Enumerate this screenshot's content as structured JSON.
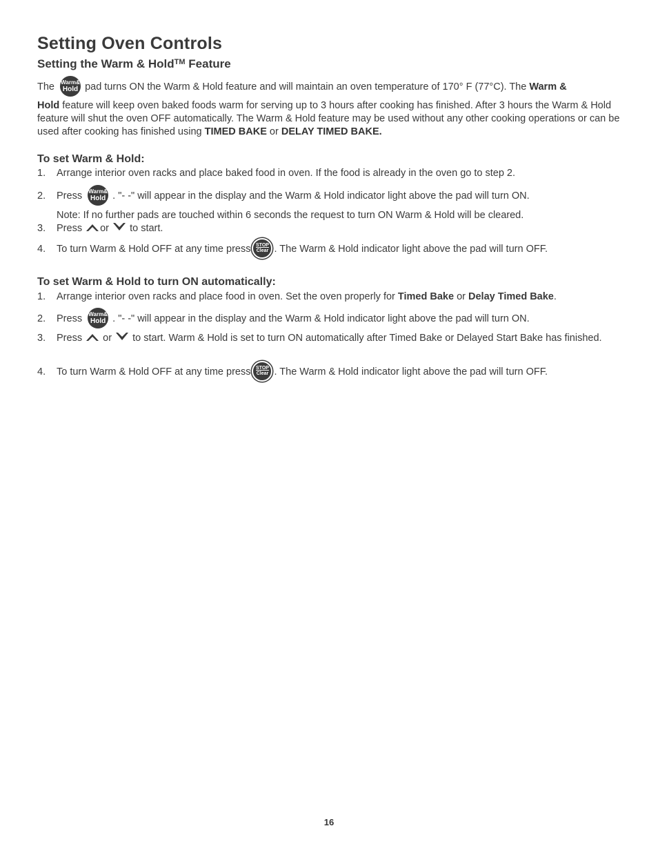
{
  "title": "Setting Oven Controls",
  "subtitle": "Setting the Warm & Hold",
  "subtitle_tm": "TM",
  "subtitle_end": " Feature",
  "icons": {
    "warm_hold_pad": {
      "name": "warm-hold-pad-icon",
      "line1": "Warm&",
      "line2": "Hold"
    },
    "stop_clear_pad": {
      "name": "stop-clear-pad-icon",
      "line1": "STOP",
      "line2": "Clear"
    },
    "up_arrow": "up-arrow-icon",
    "down_arrow": "down-arrow-icon"
  },
  "intro": {
    "p1_a": "The",
    "p1_b": "pad turns ON the Warm & Hold feature and will maintain an oven temperature of 170° F (77°C). The",
    "p1_bold1": "Warm &",
    "p2_bold": "Hold",
    "p2_a": "feature will keep oven baked foods warm for serving up to 3 hours after cooking has finished. After 3 hours the Warm & Hold feature will shut the oven OFF automatically. The Warm & Hold feature may be used without any other cooking operations or can be used after cooking has finished using",
    "p2_bold2": "TIMED BAKE",
    "p2_or": "or",
    "p2_bold3": "DELAY TIMED BAKE."
  },
  "section1": {
    "heading": "To set Warm & Hold:",
    "steps": [
      {
        "num": "1.",
        "text": "Arrange interior oven racks and place baked food in oven. If the food is already in the oven go to step 2."
      },
      {
        "num": "2.",
        "text_a": "Press",
        "text_b": ".  \"- -\" will appear in the display and the Warm & Hold indicator light above the pad will turn ON."
      },
      {
        "note": "Note: If no further pads are touched within 6 seconds the request to turn ON Warm & Hold will be cleared."
      },
      {
        "num": "3.",
        "text_a": "Press",
        "text_or": "or",
        "text_b": "to start."
      },
      {
        "num": "4.",
        "text_a": "To turn Warm & Hold OFF at any time press",
        "text_b": ". The Warm & Hold indicator light above the pad will turn OFF."
      }
    ]
  },
  "section2": {
    "heading": "To set Warm & Hold to turn ON automatically:",
    "steps": [
      {
        "num": "1.",
        "text_a": "Arrange interior oven racks and place food in oven. Set the oven properly for",
        "bold1": "Timed Bake",
        "text_or": "or",
        "bold2": "Delay Timed Bake",
        "text_end": "."
      },
      {
        "num": "2.",
        "text_a": "Press",
        "text_b": ".  \"- -\" will appear in the display and the Warm & Hold indicator light above the pad will turn ON."
      },
      {
        "num": "3.",
        "text_a": "Press",
        "text_or": "or",
        "text_b": "to start. Warm & Hold is set to turn ON automatically after Timed Bake or Delayed Start Bake has finished."
      },
      {
        "num": "4.",
        "text_a": "To turn Warm & Hold OFF at any time press",
        "text_b": ". The Warm & Hold indicator light above the pad will turn OFF."
      }
    ]
  },
  "page_number": "16"
}
